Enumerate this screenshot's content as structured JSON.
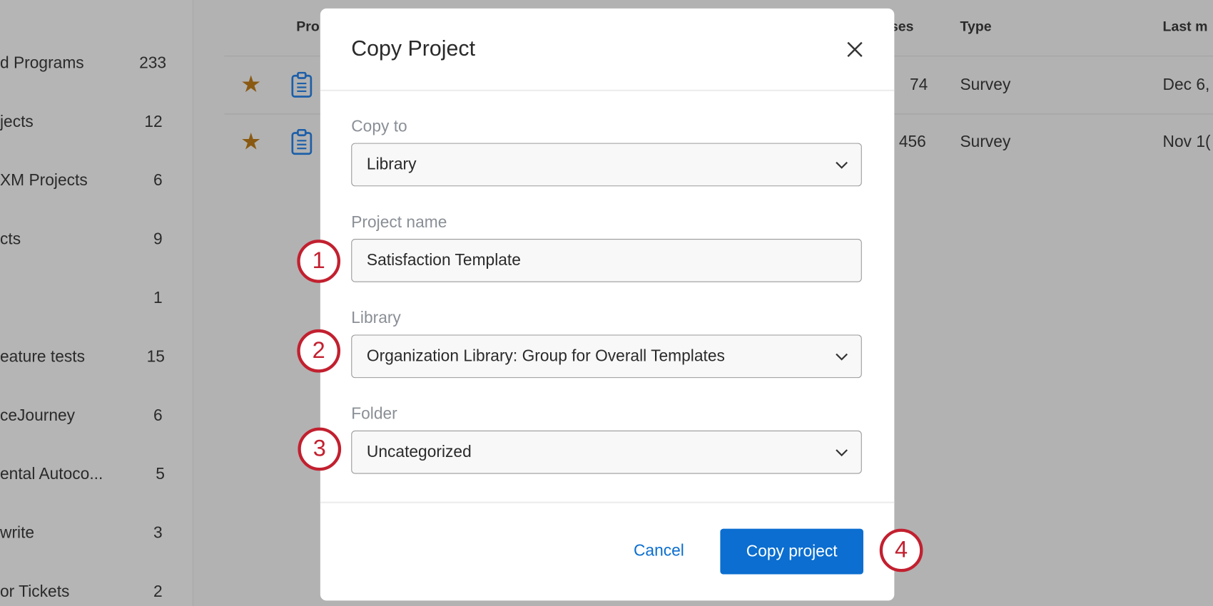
{
  "sidebar": {
    "items": [
      {
        "label": "d Programs",
        "count": "233"
      },
      {
        "label": "jects",
        "count": "12"
      },
      {
        "label": "XM Projects",
        "count": "6"
      },
      {
        "label": "cts",
        "count": "9"
      },
      {
        "label": "",
        "count": "1"
      },
      {
        "label": "eature tests",
        "count": "15"
      },
      {
        "label": "ceJourney",
        "count": "6"
      },
      {
        "label": "ental Autoco...",
        "count": "5"
      },
      {
        "label": "write",
        "count": "3"
      },
      {
        "label": "or Tickets",
        "count": "2"
      }
    ]
  },
  "table": {
    "headers": {
      "project": "Pro",
      "responses": "nses",
      "type": "Type",
      "last": "Last m"
    },
    "rows": [
      {
        "responses": "74",
        "type": "Survey",
        "last": "Dec 6,"
      },
      {
        "responses": "456",
        "type": "Survey",
        "last": "Nov 1("
      }
    ]
  },
  "modal": {
    "title": "Copy Project",
    "copy_to_label": "Copy to",
    "copy_to_value": "Library",
    "project_name_label": "Project name",
    "project_name_value": "Satisfaction Template",
    "library_label": "Library",
    "library_value": "Organization Library: Group for Overall Templates",
    "folder_label": "Folder",
    "folder_value": "Uncategorized",
    "cancel_label": "Cancel",
    "submit_label": "Copy project"
  },
  "callouts": [
    "1",
    "2",
    "3",
    "4"
  ],
  "colors": {
    "primary": "#0b6ed0",
    "callout": "#c2202f",
    "star": "#8a5a12"
  }
}
